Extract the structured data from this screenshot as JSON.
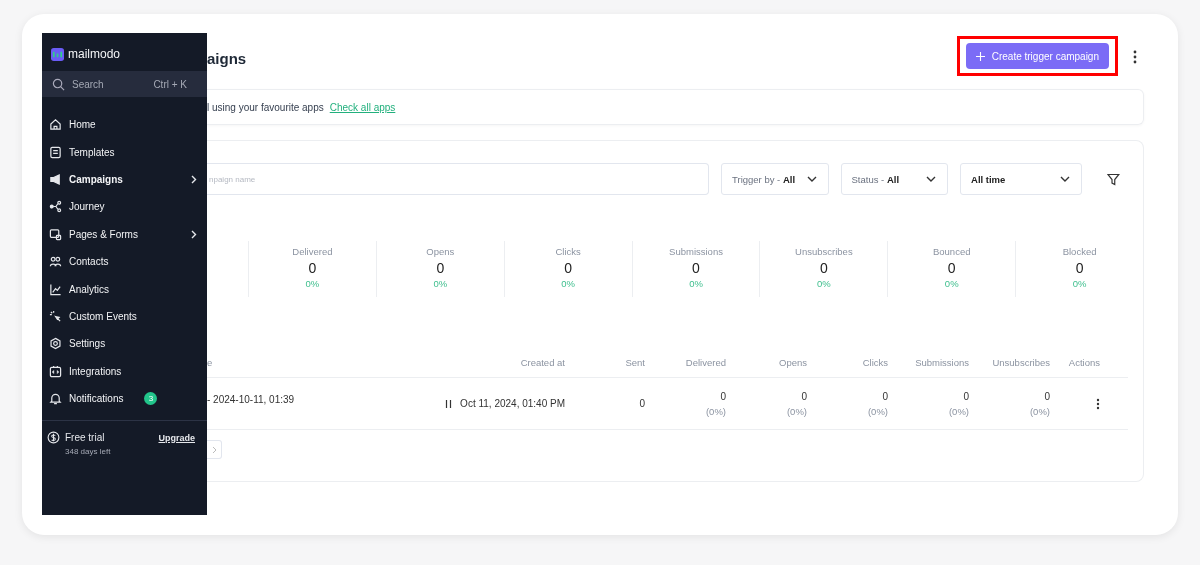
{
  "sidebar": {
    "brand": "mailmodo",
    "search": {
      "placeholder": "Search",
      "shortcut": "Ctrl + K"
    },
    "items": [
      {
        "label": "Home",
        "has_submenu": false,
        "selected": false
      },
      {
        "label": "Templates",
        "has_submenu": false,
        "selected": false
      },
      {
        "label": "Campaigns",
        "has_submenu": true,
        "selected": true
      },
      {
        "label": "Journey",
        "has_submenu": false,
        "selected": false
      },
      {
        "label": "Pages & Forms",
        "has_submenu": true,
        "selected": false
      },
      {
        "label": "Contacts",
        "has_submenu": false,
        "selected": false
      },
      {
        "label": "Analytics",
        "has_submenu": false,
        "selected": false
      },
      {
        "label": "Custom Events",
        "has_submenu": false,
        "selected": false
      },
      {
        "label": "Settings",
        "has_submenu": false,
        "selected": false
      },
      {
        "label": "Integrations",
        "has_submenu": false,
        "selected": false
      },
      {
        "label": "Notifications",
        "has_submenu": false,
        "selected": false,
        "badge": "3"
      }
    ],
    "plan": {
      "label": "Free trial",
      "remaining": "348 days left",
      "action": "Upgrade"
    }
  },
  "header": {
    "title": "aigns",
    "primary_button": "Create trigger campaign",
    "highlighted": true
  },
  "banner": {
    "text": "l using your favourite apps",
    "link": "Check all apps"
  },
  "filters": {
    "search_placeholder": "npaign name",
    "dropdowns": [
      {
        "label": "Trigger by - ",
        "value": "All",
        "kind": "prefixed"
      },
      {
        "label": "Status - ",
        "value": "All",
        "kind": "prefixed"
      },
      {
        "value": "All time",
        "kind": "plain"
      }
    ]
  },
  "stats": [
    {
      "label": "Delivered",
      "value": "0",
      "rate": "0%"
    },
    {
      "label": "Opens",
      "value": "0",
      "rate": "0%"
    },
    {
      "label": "Clicks",
      "value": "0",
      "rate": "0%"
    },
    {
      "label": "Submissions",
      "value": "0",
      "rate": "0%"
    },
    {
      "label": "Unsubscribes",
      "value": "0",
      "rate": "0%"
    },
    {
      "label": "Bounced",
      "value": "0",
      "rate": "0%"
    },
    {
      "label": "Blocked",
      "value": "0",
      "rate": "0%"
    }
  ],
  "table": {
    "columns": [
      "e",
      "Created at",
      "Sent",
      "Delivered",
      "Opens",
      "Clicks",
      "Submissions",
      "Unsubscribes",
      "Actions"
    ],
    "rows": [
      {
        "name": "- 2024-10-11, 01:39",
        "created_at": "Oct 11, 2024, 01:40 PM",
        "sent": "0",
        "metrics": [
          {
            "value": "0",
            "rate": "(0%)"
          },
          {
            "value": "0",
            "rate": "(0%)"
          },
          {
            "value": "0",
            "rate": "(0%)"
          },
          {
            "value": "0",
            "rate": "(0%)"
          },
          {
            "value": "0",
            "rate": "(0%)"
          }
        ]
      }
    ]
  }
}
